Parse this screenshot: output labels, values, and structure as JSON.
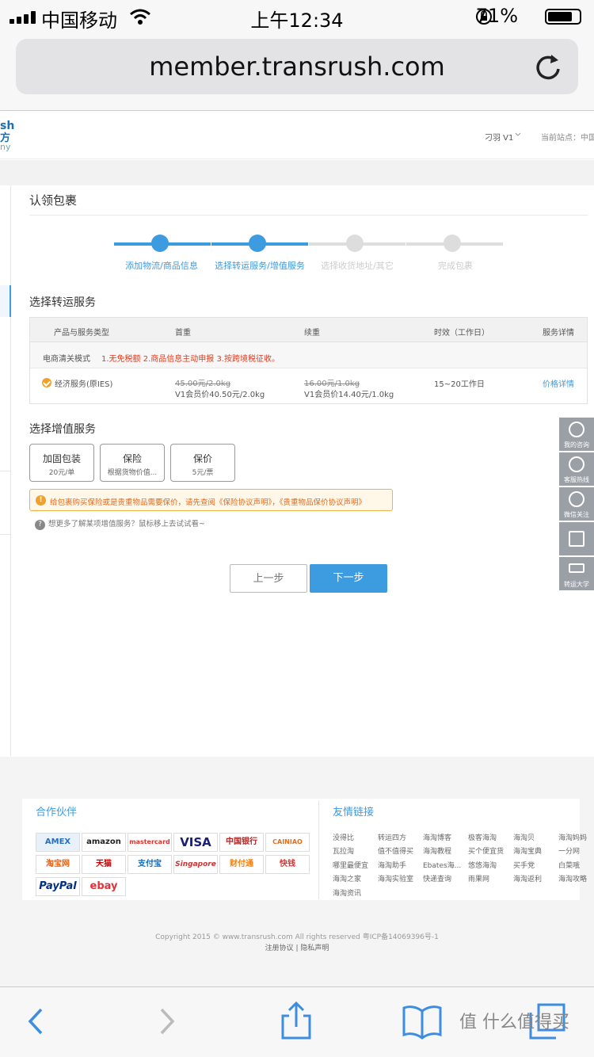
{
  "status_bar": {
    "carrier": "中国移动",
    "time": "上午12:34",
    "battery": "71%"
  },
  "browser": {
    "url": "member.transrush.com"
  },
  "site_header": {
    "logo_line1": "sh",
    "logo_line2": "方",
    "logo_line3": "ny",
    "user": "刁羽 V1",
    "station": "当前站点：中国大"
  },
  "page": {
    "title": "认领包裹",
    "steps": [
      {
        "label": "添加物流/商品信息",
        "active": true
      },
      {
        "label": "选择转运服务/增值服务",
        "active": true
      },
      {
        "label": "选择收货地址/其它",
        "active": false
      },
      {
        "label": "完成包裹",
        "active": false
      }
    ],
    "transport_title": "选择转运服务",
    "table": {
      "headers": [
        "产品与服务类型",
        "首重",
        "续重",
        "时效（工作日）",
        "服务详情"
      ],
      "mode_label": "电商清关模式",
      "mode_note": "1.无免税额 2.商品信息主动申报 3.按跨境税征收。",
      "row": {
        "service": "经济服务(原IES)",
        "first_orig": "45.00元/2.0kg",
        "first_member": "V1会员价40.50元/2.0kg",
        "cont_orig": "16.00元/1.0kg",
        "cont_member": "V1会员价14.40元/1.0kg",
        "time": "15~20工作日",
        "detail": "价格详情"
      }
    },
    "addon_title": "选择增值服务",
    "addons": [
      {
        "name": "加固包装",
        "price": "20元/单"
      },
      {
        "name": "保险",
        "price": "根据货物价值..."
      },
      {
        "name": "保价",
        "price": "5元/票"
      }
    ],
    "notice": {
      "icon": "!",
      "prefix": "给包裹购买保险或是贵重物品需要保价，请先查阅",
      "link1": "《保险协议声明》",
      "sep": "，",
      "link2": "《贵重物品保价协议声明》"
    },
    "help": {
      "icon": "?",
      "text": "想更多了解某项增值服务？鼠标移上去试试看~"
    },
    "prev_button": "上一步",
    "next_button": "下一步"
  },
  "side_float": [
    "我的咨询",
    "客服热线",
    "微信关注",
    "",
    "转运大学"
  ],
  "footer": {
    "partners_title": "合作伙伴",
    "links_title": "友情链接",
    "partners": [
      "AMEX",
      "amazon",
      "mastercard",
      "VISA",
      "中国银行",
      "CAINIAO",
      "淘宝网",
      "天猫",
      "支付宝",
      "Singapore",
      "财付通",
      "快钱",
      "PayPal",
      "ebay"
    ],
    "links": [
      "没得比",
      "转运四方",
      "海淘博客",
      "极客海淘",
      "海淘贝",
      "海淘妈妈",
      "瓦拉淘",
      "值不值得买",
      "海淘教程",
      "买个便宜货",
      "海淘宝典",
      "一分网",
      "哪里最便宜",
      "海淘助手",
      "Ebates海...",
      "悠悠海淘",
      "买手党",
      "白菜哦",
      "海淘之家",
      "海淘实验室",
      "快递查询",
      "雨果网",
      "海淘返利",
      "海淘攻略",
      "海淘资讯"
    ],
    "copyright": "Copyright 2015 © www.transrush.com All rights reserved 粤ICP备14069396号-1",
    "agreements": "注册协议  |  隐私声明"
  },
  "watermark": "值 什么值得买",
  "colors": {
    "accent": "#3d9be0",
    "warning": "#e06a1f",
    "red": "#e03c1f"
  }
}
